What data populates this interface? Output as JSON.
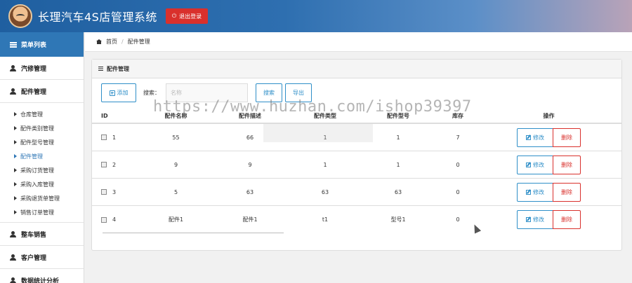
{
  "header": {
    "title": "长理汽车4S店管理系统",
    "logout_label": "退出登录"
  },
  "sidebar": {
    "menu_title": "菜单列表",
    "groups": [
      {
        "label": "汽修管理"
      },
      {
        "label": "配件管理"
      },
      {
        "label": "整车销售"
      },
      {
        "label": "客户管理"
      },
      {
        "label": "数据统计分析"
      }
    ],
    "parts_items": [
      {
        "label": "仓库管理"
      },
      {
        "label": "配件类别管理"
      },
      {
        "label": "配件型号管理"
      },
      {
        "label": "配件管理"
      },
      {
        "label": "采购订货管理"
      },
      {
        "label": "采购入库管理"
      },
      {
        "label": "采购退货单管理"
      },
      {
        "label": "销售订单管理"
      }
    ],
    "active_item": "配件管理"
  },
  "breadcrumb": {
    "home": "首页",
    "current": "配件管理"
  },
  "panel": {
    "title": "配件管理",
    "add_label": "添加",
    "search_label": "搜索：",
    "search_placeholder": "名称",
    "search_button": "搜索",
    "export_button": "导出"
  },
  "table": {
    "headers": {
      "id": "ID",
      "name": "配件名称",
      "desc": "配件描述",
      "type": "配件类型",
      "model": "配件型号",
      "stock": "库存",
      "ops": "操作"
    },
    "rows": [
      {
        "id": "1",
        "name": "55",
        "desc": "66",
        "type": "1",
        "model": "1",
        "stock": "7"
      },
      {
        "id": "2",
        "name": "9",
        "desc": "9",
        "type": "1",
        "model": "1",
        "stock": "0"
      },
      {
        "id": "3",
        "name": "5",
        "desc": "63",
        "type": "63",
        "model": "63",
        "stock": "0"
      },
      {
        "id": "4",
        "name": "配件1",
        "desc": "配件1",
        "type": "t1",
        "model": "型号1",
        "stock": "0"
      }
    ],
    "edit_label": "修改",
    "delete_label": "删除"
  },
  "watermark": "https://www.huzhan.com/ishop39397"
}
